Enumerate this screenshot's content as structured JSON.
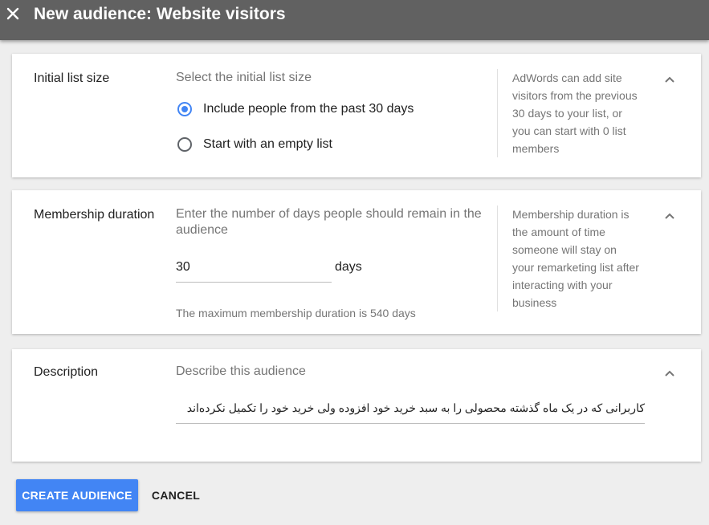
{
  "header": {
    "title": "New audience: Website visitors",
    "close_icon": "close-icon"
  },
  "initial_list": {
    "label": "Initial list size",
    "prompt": "Select the initial list size",
    "options": [
      {
        "label": "Include people from the past 30 days",
        "checked": true
      },
      {
        "label": "Start with an empty list",
        "checked": false
      }
    ],
    "help": "AdWords can add site visitors from the previous 30 days to your list, or you can start with 0 list members"
  },
  "membership": {
    "label": "Membership duration",
    "prompt": "Enter the number of days people should remain in the audience",
    "value": "30",
    "unit": "days",
    "hint": "The maximum membership duration is 540 days",
    "help": "Membership duration is the amount of time someone will stay on your remarketing list after interacting with your business"
  },
  "description": {
    "label": "Description",
    "prompt": "Describe this audience",
    "value": "کاربرانی که در یک ماه گذشته محصولی را به سبد خرید خود افزوده ولی خرید خود را تکمیل نکرده‌اند"
  },
  "actions": {
    "create_label": "CREATE AUDIENCE",
    "cancel_label": "CANCEL"
  },
  "colors": {
    "header_bg": "#616161",
    "accent": "#4285f4",
    "page_bg": "#eeeeee"
  }
}
